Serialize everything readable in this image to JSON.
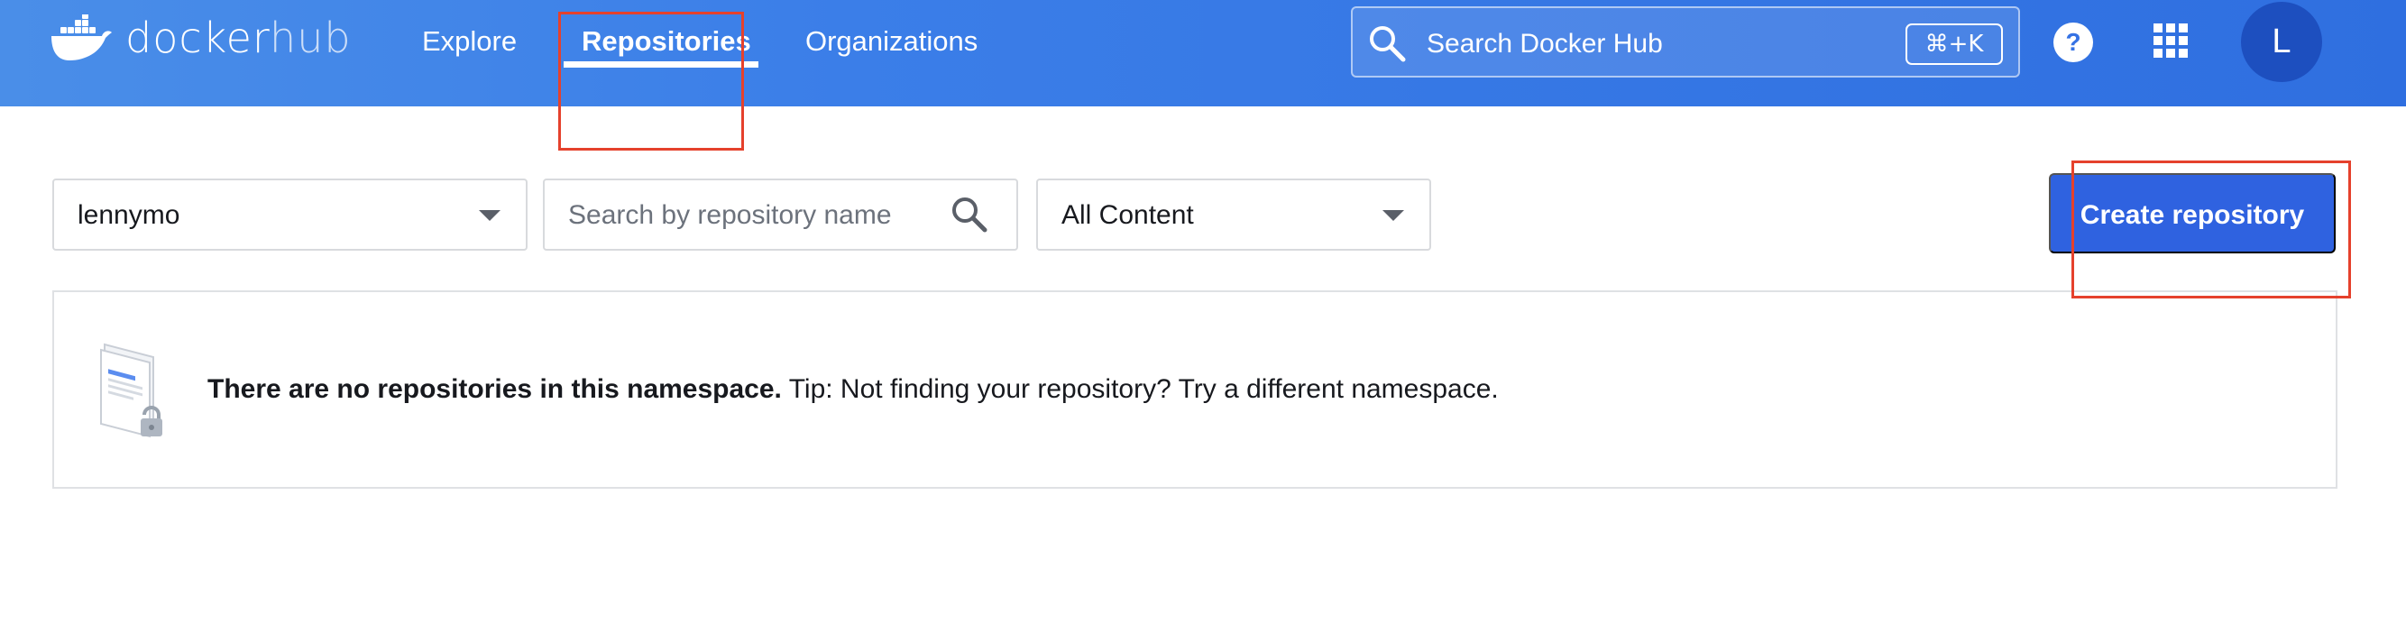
{
  "brand": {
    "name_primary": "docker",
    "name_secondary": "hub"
  },
  "nav": {
    "items": [
      {
        "label": "Explore"
      },
      {
        "label": "Repositories"
      },
      {
        "label": "Organizations"
      }
    ]
  },
  "search": {
    "placeholder": "Search Docker Hub",
    "shortcut": "⌘+K"
  },
  "user": {
    "initial": "L"
  },
  "filters": {
    "namespace": "lennymo",
    "repo_search_placeholder": "Search by repository name",
    "content_filter": "All Content"
  },
  "actions": {
    "create_label": "Create repository"
  },
  "empty_state": {
    "title": "There are no repositories in this namespace.",
    "tip": "Tip: Not finding your repository? Try a different namespace."
  },
  "colors": {
    "header_gradient_start": "#4a8ee8",
    "header_gradient_end": "#2f6fe0",
    "primary_button": "#2f62e0",
    "avatar_bg": "#1d4fbf",
    "highlight_box": "#e5412c"
  },
  "icons": [
    "docker-whale-icon",
    "search-icon",
    "help-icon",
    "apps-grid-icon",
    "chevron-down-icon",
    "empty-repository-illustration"
  ]
}
